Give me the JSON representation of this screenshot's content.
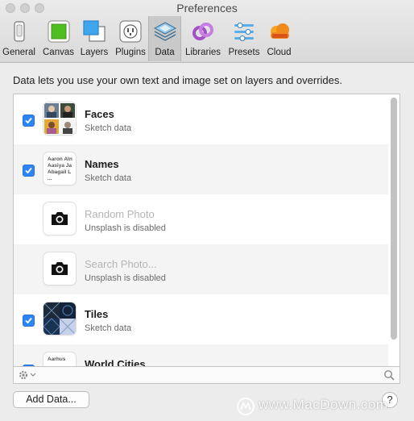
{
  "window": {
    "title": "Preferences"
  },
  "toolbar": {
    "items": [
      {
        "label": "General",
        "icon": "general-icon"
      },
      {
        "label": "Canvas",
        "icon": "canvas-icon"
      },
      {
        "label": "Layers",
        "icon": "layers-icon"
      },
      {
        "label": "Plugins",
        "icon": "plugins-icon"
      },
      {
        "label": "Data",
        "icon": "data-icon",
        "selected": true
      },
      {
        "label": "Libraries",
        "icon": "libraries-icon"
      },
      {
        "label": "Presets",
        "icon": "presets-icon"
      },
      {
        "label": "Cloud",
        "icon": "cloud-icon"
      }
    ]
  },
  "intro": "Data lets you use your own text and image set on layers and overrides.",
  "data_sets": [
    {
      "name": "Faces",
      "subtitle": "Sketch data",
      "checked": true,
      "enabled": true
    },
    {
      "name": "Names",
      "subtitle": "Sketch data",
      "checked": true,
      "enabled": true,
      "preview_text": [
        "Aaron Aln",
        "Aasiya Ja",
        "Abagail L",
        "..."
      ]
    },
    {
      "name": "Random Photo",
      "subtitle": "Unsplash is disabled",
      "checked": false,
      "enabled": false
    },
    {
      "name": "Search Photo...",
      "subtitle": "Unsplash is disabled",
      "checked": false,
      "enabled": false
    },
    {
      "name": "Tiles",
      "subtitle": "Sketch data",
      "checked": true,
      "enabled": true
    },
    {
      "name": "World Cities",
      "subtitle": "",
      "checked": true,
      "enabled": true,
      "preview_text": [
        "Aarhus"
      ]
    }
  ],
  "footer": {
    "add_button": "Add Data...",
    "help_button": "?"
  },
  "watermark": "www.MacDown.com",
  "colors": {
    "accent": "#2d84f5",
    "selected_tab": "#c9c9c9"
  }
}
